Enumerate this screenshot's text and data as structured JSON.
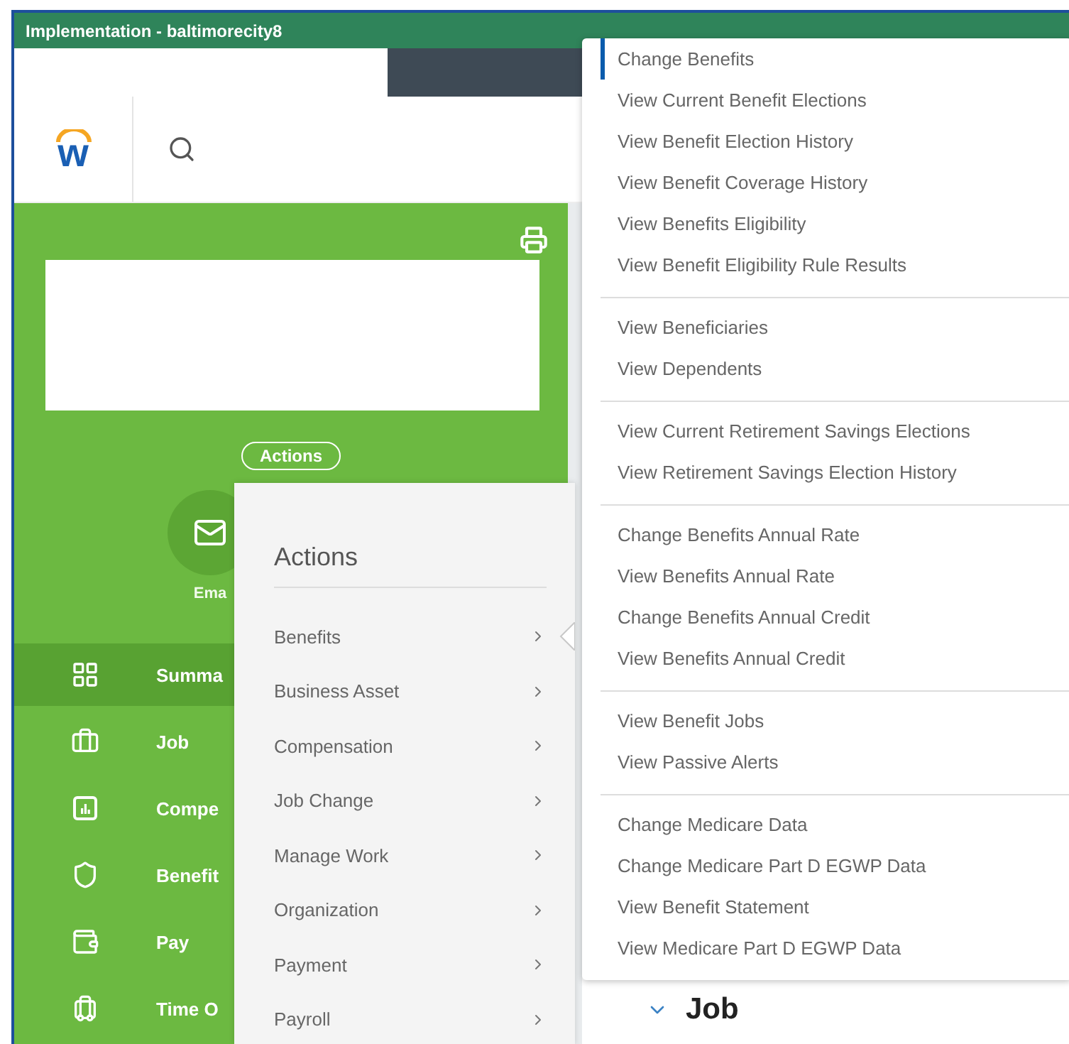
{
  "window": {
    "title": "Implementation - baltimorecity8"
  },
  "logo": {
    "letter": "w"
  },
  "profile": {
    "actions_button": "Actions",
    "email_label": "Ema"
  },
  "nav": [
    {
      "label": "Summa",
      "selected": true
    },
    {
      "label": "Job",
      "selected": false
    },
    {
      "label": "Compe",
      "selected": false
    },
    {
      "label": "Benefit",
      "selected": false
    },
    {
      "label": "Pay",
      "selected": false
    },
    {
      "label": "Time O",
      "selected": false
    }
  ],
  "actions_menu": {
    "title": "Actions",
    "items": [
      {
        "label": "Benefits",
        "selected": true
      },
      {
        "label": "Business Asset",
        "selected": false
      },
      {
        "label": "Compensation",
        "selected": false
      },
      {
        "label": "Job Change",
        "selected": false
      },
      {
        "label": "Manage Work",
        "selected": false
      },
      {
        "label": "Organization",
        "selected": false
      },
      {
        "label": "Payment",
        "selected": false
      },
      {
        "label": "Payroll",
        "selected": false
      }
    ]
  },
  "submenu": {
    "groups": [
      {
        "items": [
          {
            "label": "Change Benefits",
            "selected": true
          },
          {
            "label": "View Current Benefit Elections",
            "selected": false
          },
          {
            "label": "View Benefit Election History",
            "selected": false
          },
          {
            "label": "View Benefit Coverage History",
            "selected": false
          },
          {
            "label": "View Benefits Eligibility",
            "selected": false
          },
          {
            "label": "View Benefit Eligibility Rule Results",
            "selected": false
          }
        ]
      },
      {
        "items": [
          {
            "label": "View Beneficiaries",
            "selected": false
          },
          {
            "label": "View Dependents",
            "selected": false
          }
        ]
      },
      {
        "items": [
          {
            "label": "View Current Retirement Savings Elections",
            "selected": false
          },
          {
            "label": "View Retirement Savings Election History",
            "selected": false
          }
        ]
      },
      {
        "items": [
          {
            "label": "Change Benefits Annual Rate",
            "selected": false
          },
          {
            "label": "View Benefits Annual Rate",
            "selected": false
          },
          {
            "label": "Change Benefits Annual Credit",
            "selected": false
          },
          {
            "label": "View Benefits Annual Credit",
            "selected": false
          }
        ]
      },
      {
        "items": [
          {
            "label": "View Benefit Jobs",
            "selected": false
          },
          {
            "label": "View Passive Alerts",
            "selected": false
          }
        ]
      },
      {
        "items": [
          {
            "label": "Change Medicare Data",
            "selected": false
          },
          {
            "label": "Change Medicare Part D EGWP Data",
            "selected": false
          },
          {
            "label": "View Benefit Statement",
            "selected": false
          },
          {
            "label": "View Medicare Part D EGWP Data",
            "selected": false
          }
        ]
      }
    ]
  },
  "section": {
    "title": "Job",
    "expanded": true
  }
}
